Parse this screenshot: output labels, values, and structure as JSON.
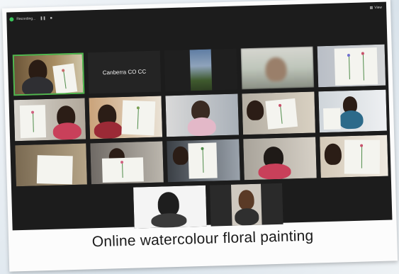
{
  "window": {
    "recording_label": "Recording...",
    "view_label": "View"
  },
  "tiles": {
    "canberra_label": "Canberra CO CC"
  },
  "caption": "Online watercolour floral painting",
  "colors": {
    "active_speaker": "#4fb84f",
    "recording": "#3ac35a",
    "background": "#1c1c1c"
  },
  "icons": {
    "recording": "recording-dot-icon",
    "pause": "pause-icon",
    "stop": "stop-icon",
    "view": "grid-view-icon"
  }
}
